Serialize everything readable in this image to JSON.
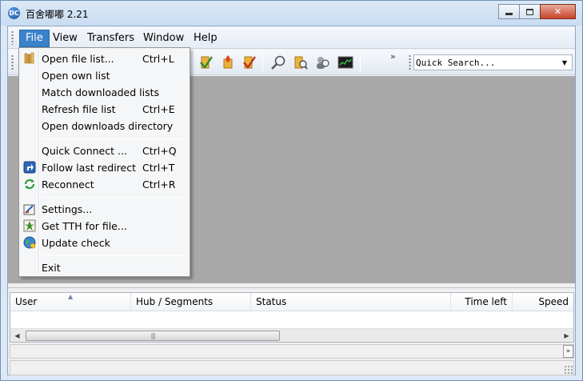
{
  "window": {
    "title": "百舍嘟嘟 2.21",
    "icon_text": "DC",
    "controls": {
      "minimize": "minimize-icon",
      "maximize": "maximize-icon",
      "close": "✕"
    }
  },
  "menubar": {
    "items": [
      "File",
      "View",
      "Transfers",
      "Window",
      "Help"
    ],
    "active": "File"
  },
  "file_menu": {
    "groups": [
      [
        {
          "label": "Open file list...",
          "shortcut": "Ctrl+L",
          "icon": "file-list-icon"
        },
        {
          "label": "Open own list",
          "shortcut": "",
          "icon": ""
        },
        {
          "label": "Match downloaded lists",
          "shortcut": "",
          "icon": ""
        },
        {
          "label": "Refresh file list",
          "shortcut": "Ctrl+E",
          "icon": ""
        },
        {
          "label": "Open downloads directory",
          "shortcut": "",
          "icon": ""
        }
      ],
      [
        {
          "label": "Quick Connect ...",
          "shortcut": "Ctrl+Q",
          "icon": ""
        },
        {
          "label": "Follow last redirect",
          "shortcut": "Ctrl+T",
          "icon": "redirect-icon"
        },
        {
          "label": "Reconnect",
          "shortcut": "Ctrl+R",
          "icon": "reconnect-icon"
        }
      ],
      [
        {
          "label": "Settings...",
          "shortcut": "",
          "icon": "settings-icon"
        },
        {
          "label": "Get TTH for file...",
          "shortcut": "",
          "icon": "tth-icon"
        },
        {
          "label": "Update check",
          "shortcut": "",
          "icon": "update-globe-icon"
        }
      ],
      [
        {
          "label": "Exit",
          "shortcut": "",
          "icon": ""
        }
      ]
    ]
  },
  "toolbar": {
    "overflow_glyph": "»",
    "quick_search_placeholder": "Quick Search...",
    "dropdown_glyph": "▼"
  },
  "transfers": {
    "columns": [
      "User",
      "Hub / Segments",
      "Status",
      "Time left",
      "Speed"
    ],
    "sort_glyph": "▲",
    "scroll_left": "◀",
    "scroll_right": "▶",
    "thumb_grip": "|||"
  },
  "statusbar": {
    "chevron": "»"
  },
  "colors": {
    "accent": "#3a82c9",
    "mdi_background": "#a8a8a8",
    "titlebar": "#dbe9f8",
    "close_button": "#c7432a"
  }
}
